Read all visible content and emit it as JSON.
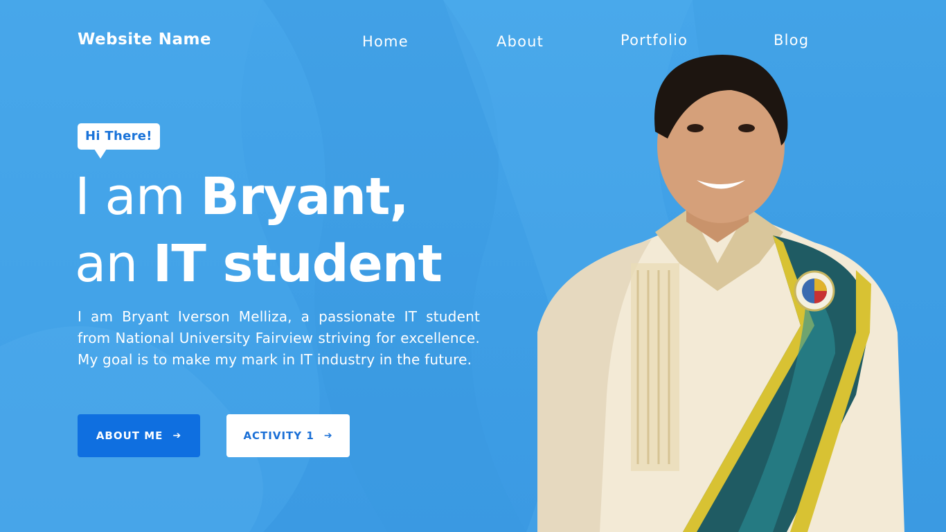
{
  "brand": {
    "name": "Website Name"
  },
  "nav": {
    "home": "Home",
    "about": "About",
    "portfolio": "Portfolio",
    "blog": "Blog"
  },
  "hero": {
    "greeting": "Hi There!",
    "headline_line1_regular": "I am ",
    "headline_line1_bold": "Bryant,",
    "headline_line2_regular": "an ",
    "headline_line2_bold": "IT student",
    "intro": "I am Bryant Iverson Melliza, a passionate IT student from National University Fairview striving for excellence. My goal is to make my mark in IT industry in the future."
  },
  "buttons": {
    "about_me": "ABOUT ME",
    "activity": "ACTIVITY 1",
    "arrow_icon": "arrow-right-icon"
  },
  "colors": {
    "background": "#3fa0e6",
    "primary_button": "#0f6fe0",
    "accent_text": "#1a73d9",
    "white": "#ffffff"
  }
}
